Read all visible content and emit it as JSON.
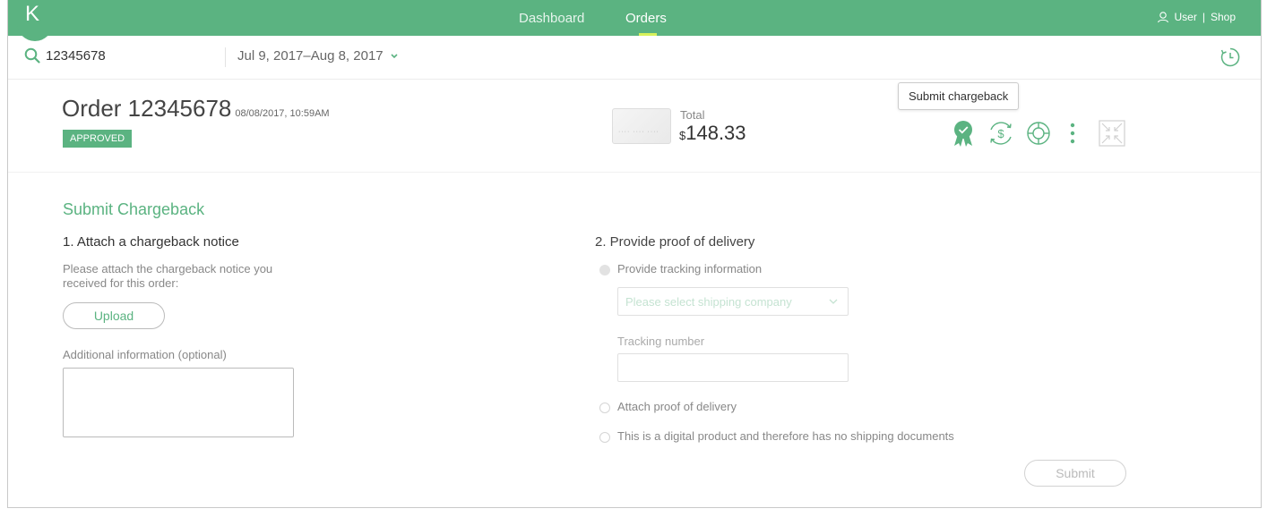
{
  "nav": {
    "logo": "K",
    "items": [
      {
        "label": "Dashboard",
        "active": false
      },
      {
        "label": "Orders",
        "active": true
      }
    ],
    "user_label": "User",
    "shop_label": "Shop",
    "separator": "|"
  },
  "search": {
    "value": "12345678",
    "date_range": "Jul 9, 2017–Aug 8, 2017"
  },
  "order": {
    "title": "Order 12345678",
    "date": "08/08/2017, 10:59AM",
    "status": "APPROVED",
    "total_label": "Total",
    "currency": "$",
    "total_amount": "148.33",
    "tooltip": "Submit chargeback",
    "actions": [
      "award-ribbon-icon",
      "refund-icon",
      "lifebuoy-icon",
      "more-vertical-icon",
      "collapse-icon"
    ]
  },
  "form": {
    "section_title": "Submit Chargeback",
    "step1": {
      "title": "1. Attach a chargeback notice",
      "help": "Please attach the chargeback notice you received for this order:",
      "upload_label": "Upload",
      "additional_label": "Additional information (optional)"
    },
    "step2": {
      "title": "2. Provide proof of delivery",
      "options": [
        {
          "label": "Provide tracking information",
          "selected": true
        },
        {
          "label": "Attach proof of delivery",
          "selected": false
        },
        {
          "label": "This is a digital product and therefore has no shipping documents",
          "selected": false
        }
      ],
      "shipping_placeholder": "Please select shipping company",
      "tracking_label": "Tracking number"
    },
    "submit_label": "Submit"
  },
  "colors": {
    "brand_green": "#5bb381",
    "underline_accent": "#d7f25a"
  }
}
